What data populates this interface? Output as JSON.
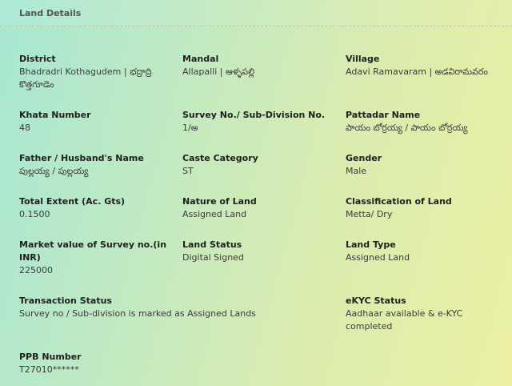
{
  "header": {
    "title": "Land Details"
  },
  "fields": {
    "district": {
      "label": "District",
      "value": "Bhadradri Kothagudem | భద్రాద్రి కొత్తగూడెం"
    },
    "mandal": {
      "label": "Mandal",
      "value": "Allapalli | ఆళ్ళపల్లి"
    },
    "village": {
      "label": "Village",
      "value": "Adavi Ramavaram | అడవిరామవరం"
    },
    "khata": {
      "label": "Khata Number",
      "value": "48"
    },
    "survey": {
      "label": "Survey No./ Sub-Division No.",
      "value": "1/అ"
    },
    "pattadar": {
      "label": "Pattadar Name",
      "value": "పాయం బోర్రయ్య / పాయం బోర్రయ్య"
    },
    "father": {
      "label": "Father / Husband's Name",
      "value": "పుల్లయ్య / పుల్లయ్య"
    },
    "caste": {
      "label": "Caste Category",
      "value": "ST"
    },
    "gender": {
      "label": "Gender",
      "value": "Male"
    },
    "extent": {
      "label": "Total Extent (Ac. Gts)",
      "value": "0.1500"
    },
    "nature": {
      "label": "Nature of Land",
      "value": "Assigned Land"
    },
    "classification": {
      "label": "Classification of Land",
      "value": "Metta/ Dry"
    },
    "market": {
      "label": "Market value of Survey no.(in INR)",
      "value": "225000"
    },
    "land_status": {
      "label": "Land Status",
      "value": "Digital Signed"
    },
    "land_type": {
      "label": "Land Type",
      "value": "Assigned Land"
    },
    "transaction": {
      "label": "Transaction Status",
      "value": "Survey no / Sub-division is marked as Assigned Lands"
    },
    "ekyc": {
      "label": "eKYC Status",
      "value": "Aadhaar available & e-KYC completed"
    },
    "ppb": {
      "label": "PPB Number",
      "value": "T27010******"
    }
  }
}
